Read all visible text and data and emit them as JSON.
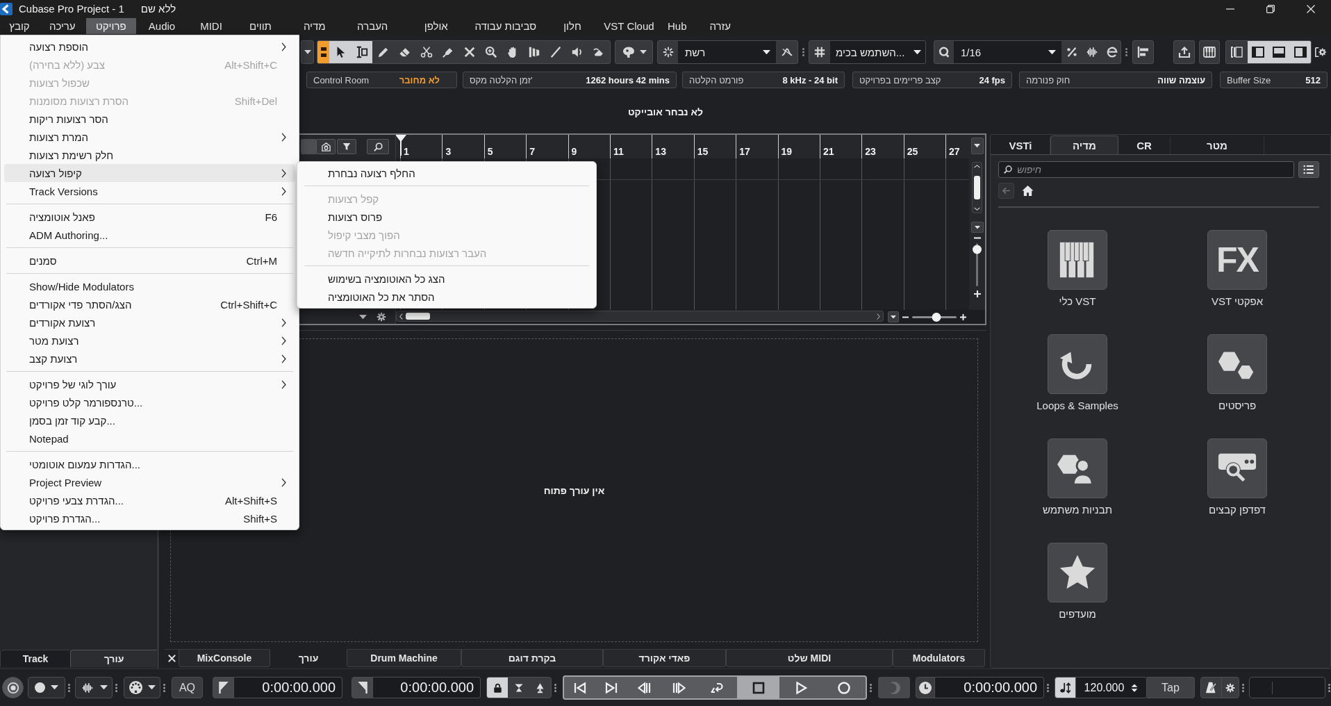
{
  "window": {
    "title": "Cubase Pro Project - 1",
    "document": "ללא שם"
  },
  "menu_bar": [
    {
      "label": "עזרה",
      "selected": false
    },
    {
      "label": "Hub",
      "selected": false
    },
    {
      "label": "VST Cloud",
      "selected": false
    },
    {
      "label": "חלון",
      "selected": false
    },
    {
      "label": "סביבות עבודה",
      "selected": false
    },
    {
      "label": "אולפן",
      "selected": false
    },
    {
      "label": "העברה",
      "selected": false
    },
    {
      "label": "מדיה",
      "selected": false
    },
    {
      "label": "תווים",
      "selected": false
    },
    {
      "label": "MIDI",
      "selected": false
    },
    {
      "label": "Audio",
      "selected": false
    },
    {
      "label": "פרויקט",
      "selected": true
    },
    {
      "label": "עריכה",
      "selected": false
    },
    {
      "label": "קובץ",
      "selected": false
    }
  ],
  "project_menu": {
    "sections": [
      {
        "items": [
          {
            "label": "הוספת רצועה",
            "disabled": false,
            "selected": false,
            "submenu": true
          },
          {
            "label": "צבע (ללא בחירה)",
            "shortcut": "Alt+Shift+C",
            "disabled": true,
            "selected": false,
            "submenu": false
          },
          {
            "label": "שכפול רצועות",
            "disabled": true,
            "selected": false,
            "submenu": false
          },
          {
            "label": "הסרת רצועות מסומנות",
            "shortcut": "Shift+Del",
            "disabled": true,
            "selected": false,
            "submenu": false
          },
          {
            "label": "הסר רצועות ריקות",
            "disabled": false,
            "selected": false,
            "submenu": false
          },
          {
            "label": "המרת רצועות",
            "disabled": false,
            "selected": false,
            "submenu": true
          },
          {
            "label": "חלק רשימת רצועות",
            "disabled": false,
            "selected": false,
            "submenu": false
          },
          {
            "label": "קיפול רצועה",
            "disabled": false,
            "selected": true,
            "submenu": true
          },
          {
            "label": "Track Versions",
            "disabled": false,
            "selected": false,
            "submenu": true
          }
        ]
      },
      {
        "items": [
          {
            "label": "פאנל אוטומציה",
            "shortcut": "F6",
            "disabled": false,
            "selected": false,
            "submenu": false
          },
          {
            "label": "ADM Authoring...",
            "disabled": false,
            "selected": false,
            "submenu": false
          }
        ]
      },
      {
        "items": [
          {
            "label": "סמנים",
            "shortcut": "Ctrl+M",
            "disabled": false,
            "selected": false,
            "submenu": false
          }
        ]
      },
      {
        "items": [
          {
            "label": "Show/Hide Modulators",
            "disabled": false,
            "selected": false,
            "submenu": false
          },
          {
            "label": "הצג/הסתר פדי אקורדים",
            "shortcut": "Ctrl+Shift+C",
            "disabled": false,
            "selected": false,
            "submenu": false
          },
          {
            "label": "רצועת אקורדים",
            "disabled": false,
            "selected": false,
            "submenu": true
          },
          {
            "label": "רצועת מטר",
            "disabled": false,
            "selected": false,
            "submenu": true
          },
          {
            "label": "רצועת קצב",
            "disabled": false,
            "selected": false,
            "submenu": true
          }
        ]
      },
      {
        "items": [
          {
            "label": "עורך לוגי של פרויקט",
            "disabled": false,
            "selected": false,
            "submenu": true
          },
          {
            "label": "טרנספורמר קלט פרויקט...",
            "disabled": false,
            "selected": false,
            "submenu": false
          },
          {
            "label": "קבע קוד זמן בסמן...",
            "disabled": false,
            "selected": false,
            "submenu": false
          },
          {
            "label": "Notepad",
            "disabled": false,
            "selected": false,
            "submenu": false
          }
        ]
      },
      {
        "items": [
          {
            "label": "הגדרות עמעום אוטומטי...",
            "disabled": false,
            "selected": false,
            "submenu": false
          },
          {
            "label": "Project Preview",
            "disabled": false,
            "selected": false,
            "submenu": true
          },
          {
            "label": "הגדרת צבעי פרויקט...",
            "shortcut": "Alt+Shift+S",
            "disabled": false,
            "selected": false,
            "submenu": false
          },
          {
            "label": "הגדרת פרויקט...",
            "shortcut": "Shift+S",
            "disabled": false,
            "selected": false,
            "submenu": false
          }
        ]
      }
    ]
  },
  "track_folding_menu": {
    "sections": [
      {
        "items": [
          {
            "label": "החלף רצועה נבחרת",
            "disabled": false,
            "selected": false
          }
        ]
      },
      {
        "items": [
          {
            "label": "קפל רצועות",
            "disabled": true,
            "selected": false
          },
          {
            "label": "פרוס רצועות",
            "disabled": false,
            "selected": false
          },
          {
            "label": "הפוך מצבי קיפול",
            "disabled": true,
            "selected": false
          },
          {
            "label": "העבר רצועות נבחרות לתיקייה חדשה",
            "disabled": true,
            "selected": false
          }
        ]
      },
      {
        "items": [
          {
            "label": "הצג כל האוטומציה בשימוש",
            "disabled": false,
            "selected": false
          },
          {
            "label": "הסתר את כל האוטומציה",
            "disabled": false,
            "selected": false
          }
        ]
      }
    ]
  },
  "toolbar": {
    "strip_toggle": {
      "on": true
    },
    "tools": [
      {
        "selected": true
      },
      {
        "selected": true
      },
      {
        "selected": false
      },
      {
        "selected": false
      },
      {
        "selected": false
      },
      {
        "selected": false
      },
      {
        "selected": false
      },
      {
        "selected": false
      },
      {
        "selected": false
      },
      {
        "selected": false
      },
      {
        "selected": false
      },
      {
        "selected": false
      },
      {
        "selected": false
      }
    ],
    "grid_type": "רשת",
    "grid_mode": "השתמש בכימ...",
    "quantize": "1/16",
    "zones": [
      {
        "selected": false
      },
      {
        "selected": true
      },
      {
        "selected": true
      },
      {
        "selected": true
      }
    ]
  },
  "status_line": [
    {
      "caption": "Buffer Size",
      "reading": "512",
      "kind": "normal"
    },
    {
      "caption": "חוק פנורמה",
      "reading": "עוצמה שווה",
      "kind": "normal"
    },
    {
      "caption": "קצב פריימים בפרויקט",
      "reading": "24 fps",
      "kind": "normal"
    },
    {
      "caption": "פורמט הקלטה",
      "reading": "8 kHz - 24 bit",
      "kind": "normal"
    },
    {
      "caption": "זמן הקלטה מקס'",
      "reading": "1262 hours 42 mins",
      "kind": "normal"
    },
    {
      "caption": "Control Room",
      "reading": "לא מחובר",
      "kind": "alert"
    }
  ],
  "info_line": {
    "message": "לא נבחר אובייקט"
  },
  "left_zone": {
    "tabs": [
      {
        "label": "עורך",
        "selected": true
      },
      {
        "label": "Track",
        "selected": false
      }
    ]
  },
  "project_window": {
    "ruler": [
      "27",
      "25",
      "23",
      "21",
      "19",
      "17",
      "15",
      "13",
      "11",
      "9",
      "7",
      "5",
      "3",
      "1"
    ],
    "horizontal_zoom": {
      "level": 0.54
    },
    "vertical_zoom": {
      "level": 0.86
    }
  },
  "lower_zone": {
    "message": "אין עורך פתוח",
    "tabs": [
      {
        "label": "Modulators",
        "selected": false
      },
      {
        "label": "שלט MIDI",
        "selected": false
      },
      {
        "label": "פאדי אקורד",
        "selected": false
      },
      {
        "label": "בקרת דוגם",
        "selected": false
      },
      {
        "label": "Drum Machine",
        "selected": false
      },
      {
        "label": "עורך",
        "selected": true
      },
      {
        "label": "MixConsole",
        "selected": false
      }
    ]
  },
  "right_zone": {
    "tabs": [
      {
        "label": "מטר",
        "selected": false
      },
      {
        "label": "CR",
        "selected": false
      },
      {
        "label": "מדיה",
        "selected": true
      },
      {
        "label": "VSTi",
        "selected": false
      }
    ],
    "search": {
      "placeholder": "חיפוש"
    },
    "tile_columns": [
      {
        "tiles": [
          {
            "label": "VST אפקטי",
            "icon_text": "FX"
          },
          {
            "label": "פריסטים"
          },
          {
            "label": "דפדפן קבצים"
          }
        ]
      },
      {
        "tiles": [
          {
            "label": "כלי VST"
          },
          {
            "label": "Loops & Samples"
          },
          {
            "label": "תבניות משתמש"
          },
          {
            "label": "מועדפים"
          }
        ]
      }
    ]
  },
  "transport": {
    "quantize_button": "AQ",
    "left_locator": "0:00:00.000",
    "right_locator": "0:00:00.000",
    "lock_button": {
      "on": true
    },
    "controls": [
      {
        "on": false
      },
      {
        "on": false
      },
      {
        "on": false
      },
      {
        "on": false
      },
      {
        "on": false
      },
      {
        "on": true
      },
      {
        "on": false
      },
      {
        "on": false
      }
    ],
    "position": "0:00:00.000",
    "tempo_button": {
      "on": true
    },
    "tempo": "120.000",
    "tap_button": "Tap"
  }
}
